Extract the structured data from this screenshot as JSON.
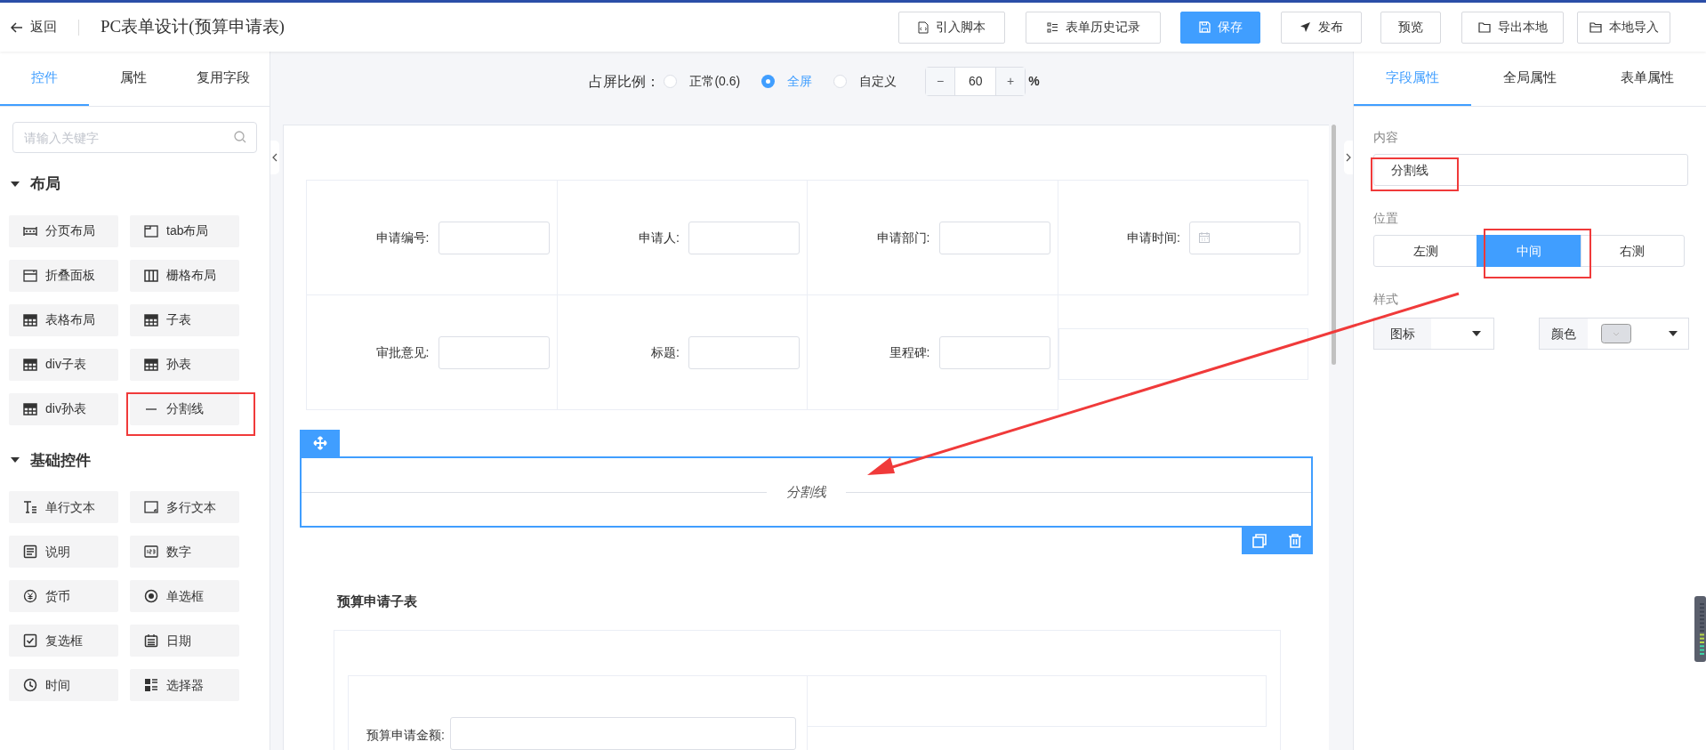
{
  "header": {
    "back": "返回",
    "title": "PC表单设计(预算申请表)",
    "buttons": [
      {
        "label": "引入脚本",
        "primary": false
      },
      {
        "label": "表单历史记录",
        "primary": false
      },
      {
        "label": "保存",
        "primary": true
      },
      {
        "label": "发布",
        "primary": false
      },
      {
        "label": "预览",
        "primary": false
      },
      {
        "label": "导出本地",
        "primary": false
      },
      {
        "label": "本地导入",
        "primary": false
      }
    ]
  },
  "left_panel": {
    "tabs": [
      {
        "label": "控件",
        "selected": true
      },
      {
        "label": "属性",
        "selected": false
      },
      {
        "label": "复用字段",
        "selected": false
      }
    ],
    "search": {
      "placeholder": "请输入关键字"
    },
    "groups": [
      {
        "title": "布局",
        "expanded": true,
        "items": [
          "分页布局",
          "tab布局",
          "折叠面板",
          "栅格布局",
          "表格布局",
          "子表",
          "div子表",
          "孙表",
          "div孙表",
          "分割线"
        ]
      },
      {
        "title": "基础控件",
        "expanded": true,
        "items": [
          "单行文本",
          "多行文本",
          "说明",
          "数字",
          "货币",
          "单选框",
          "复选框",
          "日期",
          "时间",
          "选择器"
        ]
      }
    ]
  },
  "canvas": {
    "ratio_label": "占屏比例：",
    "ratio_options": [
      {
        "label": "正常(0.6)",
        "selected": false
      },
      {
        "label": "全屏",
        "selected": true
      },
      {
        "label": "自定义",
        "selected": false
      }
    ],
    "zoom": {
      "minus": "−",
      "value": "60",
      "plus": "+",
      "unit": "%"
    },
    "form_rows": [
      [
        {
          "label": "申请编号:",
          "kind": "text"
        },
        {
          "label": "申请人:",
          "kind": "text"
        },
        {
          "label": "申请部门:",
          "kind": "text"
        },
        {
          "label": "申请时间:",
          "kind": "date"
        }
      ],
      [
        {
          "label": "审批意见:",
          "kind": "text"
        },
        {
          "label": "标题:",
          "kind": "text"
        },
        {
          "label": "里程碑:",
          "kind": "text"
        },
        {
          "kind": "empty"
        }
      ]
    ],
    "divider": {
      "text": "分割线",
      "selected": true
    },
    "subtable": {
      "title": "预算申请子表",
      "fields": [
        {
          "label": "预算申请金额:",
          "kind": "text"
        },
        {
          "kind": "empty"
        }
      ]
    }
  },
  "right_panel": {
    "tabs": [
      {
        "label": "字段属性",
        "selected": true
      },
      {
        "label": "全局属性",
        "selected": false
      },
      {
        "label": "表单属性",
        "selected": false
      }
    ],
    "content_label": "内容",
    "content_value": "分割线",
    "position_label": "位置",
    "positions": [
      {
        "label": "左测",
        "selected": false
      },
      {
        "label": "中间",
        "selected": true
      },
      {
        "label": "右测",
        "selected": false
      }
    ],
    "style_label": "样式",
    "icon_select": "图标",
    "color_select": "颜色"
  }
}
